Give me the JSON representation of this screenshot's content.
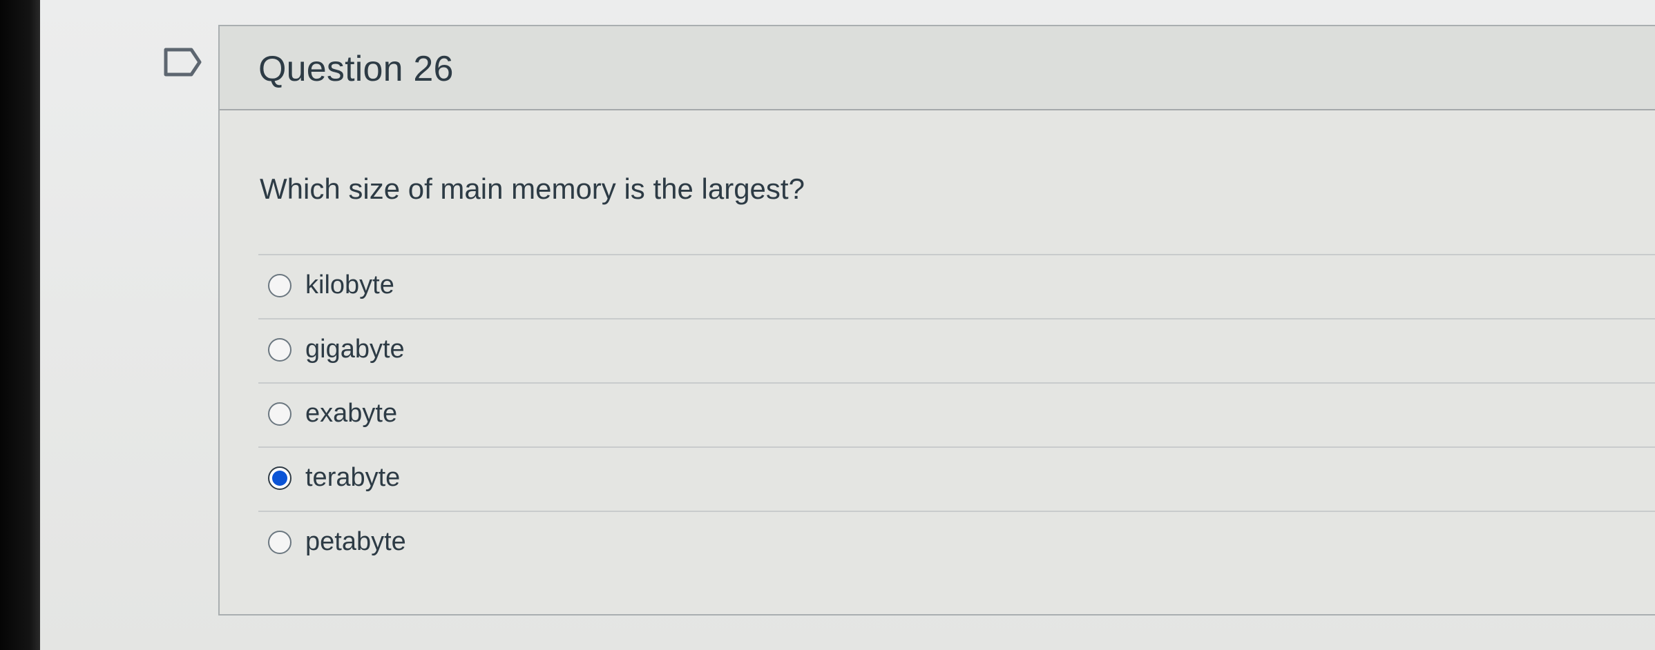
{
  "question": {
    "title": "Question 26",
    "text": "Which size of main memory is the largest?",
    "answers": [
      {
        "label": "kilobyte",
        "selected": false
      },
      {
        "label": "gigabyte",
        "selected": false
      },
      {
        "label": "exabyte",
        "selected": false
      },
      {
        "label": "terabyte",
        "selected": true
      },
      {
        "label": "petabyte",
        "selected": false
      }
    ]
  },
  "icons": {
    "flag": "flag-outline-icon"
  },
  "colors": {
    "selected_radio": "#0b54d6",
    "text": "#2d3b45",
    "header_background": "#dcdedb"
  }
}
